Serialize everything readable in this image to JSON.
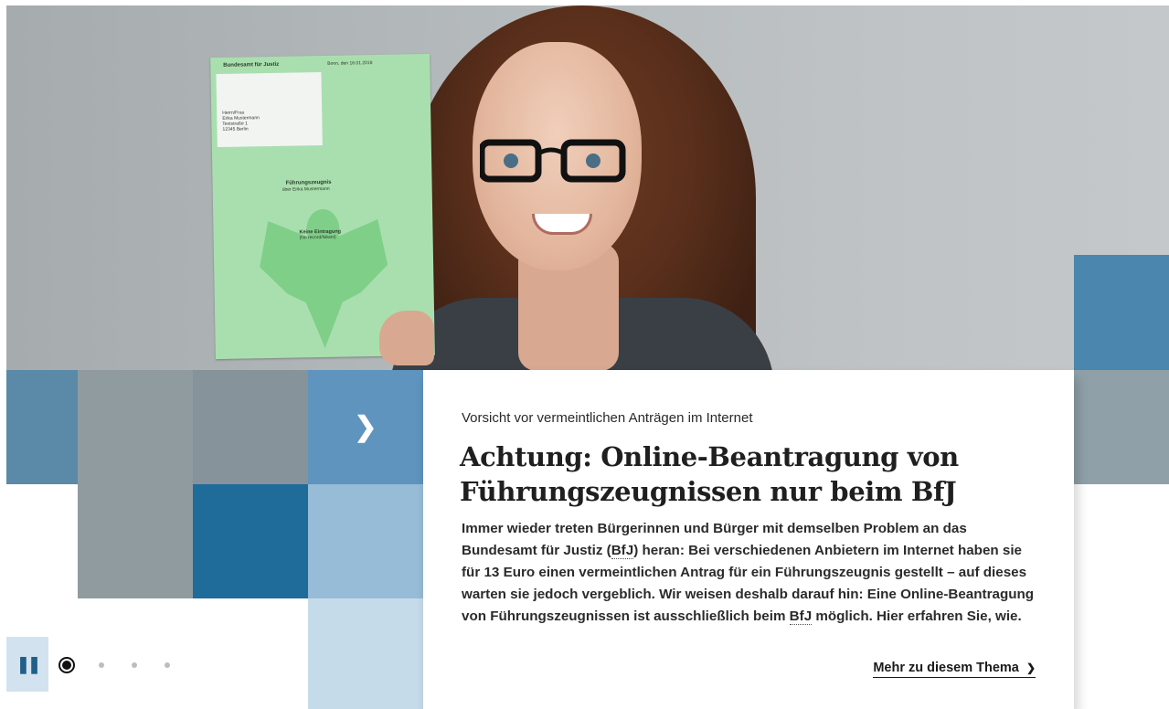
{
  "hero": {
    "document": {
      "issuer": "Bundesamt für Justiz",
      "date_line": "Bonn, den 16.01.2018",
      "recipient": [
        "Herrn/Frau",
        "Erika Mustermann",
        "Teststraße 1",
        "12345 Berlin"
      ],
      "title": "Führungszeugnis",
      "subtitle": "über Erika Mustermann",
      "stamp": "Keine Eintragung",
      "stamp_sub": "(No record/Néant)"
    }
  },
  "slider": {
    "next_icon": "chevron-right-icon",
    "next_glyph": "❯",
    "pause_icon": "pause-icon",
    "pause_glyph": "❚❚",
    "dots_total": 4,
    "active_index": 0
  },
  "article": {
    "kicker": "Vorsicht vor vermeintlichen Anträgen im Internet",
    "headline": "Achtung: Online-Beantragung von Führungs­zeugnissen nur beim BfJ",
    "body_part1": "Immer wieder treten Bürgerinnen und Bürger mit demselben Problem an das Bundesamt für Justiz (",
    "abbr1": "BfJ",
    "body_part2": ") heran: Bei verschiedenen Anbietern im Internet haben sie für 13 Euro ei­nen vermeintlichen Antrag für ein Führungszeugnis gestellt – auf dieses warten sie je­doch vergeblich. Wir weisen deshalb darauf hin: Eine Online-Beantragung von Führungs­zeugnissen ist ausschließlich beim ",
    "abbr2": "BfJ",
    "body_part3": " möglich. Hier erfahren Sie, wie.",
    "more_label": "Mehr zu diesem Thema",
    "more_icon": "chevron-right-icon",
    "more_glyph": "❯"
  },
  "colors": {
    "tile_dark_blue": "#1f6b9a",
    "tile_mid_blue": "#5e94bd",
    "tile_light_blue": "#97bcd7",
    "tile_pale_blue": "#c6dbea",
    "tile_gray": "#8f9b9f"
  }
}
